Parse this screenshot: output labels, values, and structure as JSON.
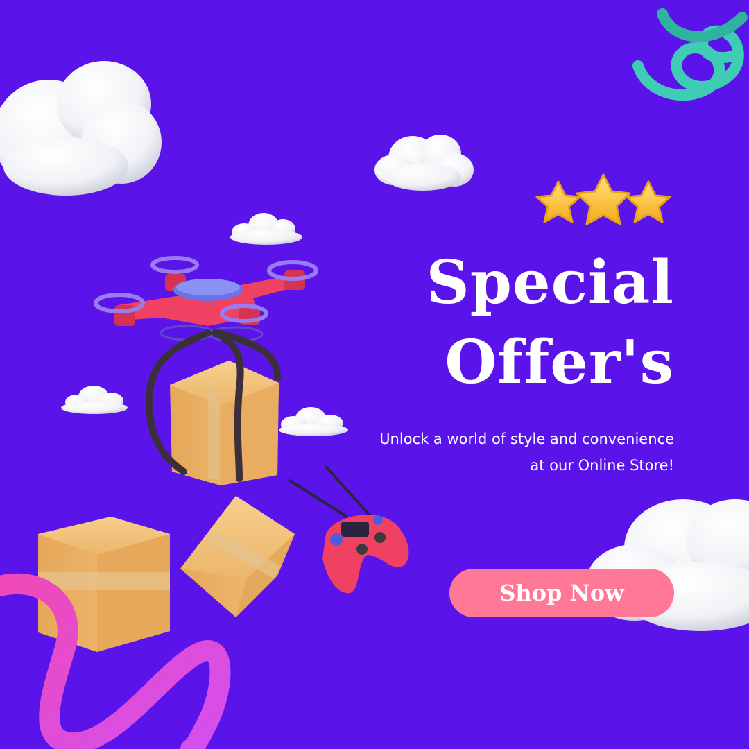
{
  "colors": {
    "background": "#5A14EA",
    "button": "#FF7895",
    "text": "#FFFFFF",
    "star": "#FBC62E",
    "spring": "#3ECCB5",
    "ribbon": "#E94FE0",
    "drone": "#EF4262",
    "box": "#F0B968"
  },
  "headline": {
    "line1": "Special",
    "line2": "Offer's"
  },
  "tagline": {
    "line1": "Unlock a world of style and convenience",
    "line2": "at our Online Store!"
  },
  "cta": {
    "label": "Shop Now"
  },
  "rating": {
    "stars": 3
  },
  "illustration": {
    "icons": [
      "cloud-icon",
      "star-icon",
      "spring-coil",
      "drone-icon",
      "parcel-box-icon",
      "game-controller-icon",
      "ribbon-swirl"
    ]
  }
}
